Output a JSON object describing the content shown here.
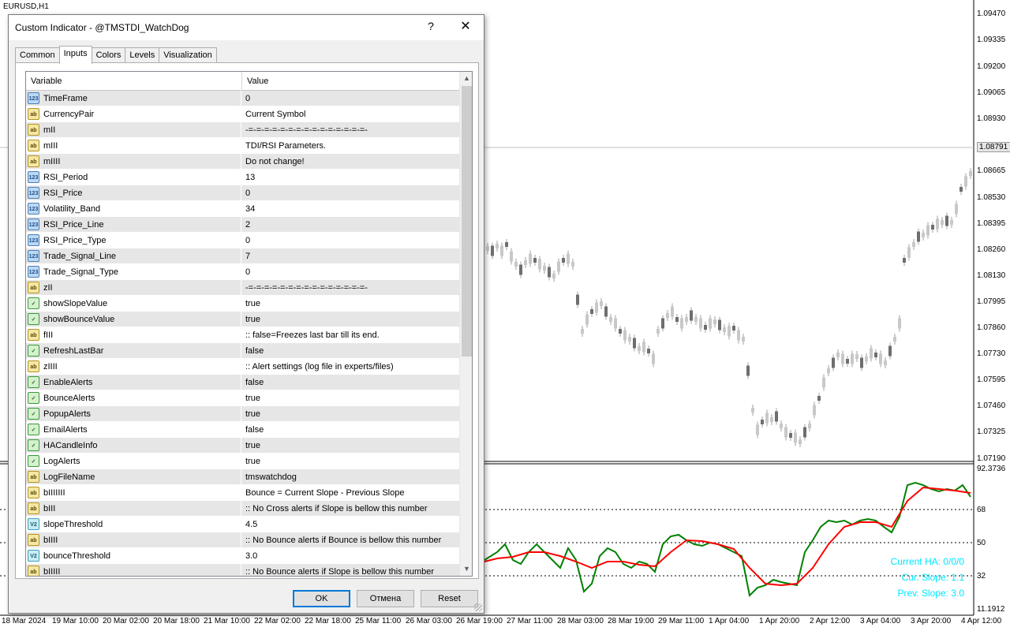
{
  "chart": {
    "symbol": "EURUSD,H1",
    "price_labels": [
      "1.09470",
      "1.09335",
      "1.09200",
      "1.09065",
      "1.08930",
      "1.08791",
      "1.08665",
      "1.08530",
      "1.08395",
      "1.08260",
      "1.08130",
      "1.07995",
      "1.07860",
      "1.07730",
      "1.07595",
      "1.07460",
      "1.07325",
      "1.07190"
    ],
    "current_price": "1.08791",
    "time_labels": [
      "18 Mar 2024",
      "19 Mar 10:00",
      "20 Mar 02:00",
      "20 Mar 18:00",
      "21 Mar 10:00",
      "22 Mar 02:00",
      "22 Mar 18:00",
      "25 Mar 11:00",
      "26 Mar 03:00",
      "26 Mar 19:00",
      "27 Mar 11:00",
      "28 Mar 03:00",
      "28 Mar 19:00",
      "29 Mar 11:00",
      "1 Apr 04:00",
      "1 Apr 20:00",
      "2 Apr 12:00",
      "3 Apr 04:00",
      "3 Apr 20:00",
      "4 Apr 12:00"
    ],
    "indicator": {
      "max_label": "92.3736",
      "min_label": "11.1912",
      "levels": [
        "68",
        "50",
        "32"
      ],
      "current_ha": "Current HA: 0/0/0",
      "cur_slope": "Cur. Slope: 1.1",
      "prev_slope": "Prev. Slope: 3.0",
      "text_color": "#00e5ff",
      "line_colors": {
        "green": "#008000",
        "red": "#ff0000"
      }
    }
  },
  "dialog": {
    "title": "Custom Indicator - @TMSTDI_WatchDog",
    "help": "?",
    "close": "✕",
    "tabs": [
      "Common",
      "Inputs",
      "Colors",
      "Levels",
      "Visualization"
    ],
    "active_tab": "Inputs",
    "grid": {
      "header_variable": "Variable",
      "header_value": "Value",
      "rows": [
        {
          "type": "int",
          "icon": "123",
          "name": "TimeFrame",
          "value": "0"
        },
        {
          "type": "str",
          "icon": "ab",
          "name": "CurrencyPair",
          "value": "Current Symbol"
        },
        {
          "type": "str",
          "icon": "ab",
          "name": "mII",
          "value": "-=-=-=-=-=-=-=-=-=-=-=-=-=-=-=-"
        },
        {
          "type": "str",
          "icon": "ab",
          "name": "mIII",
          "value": "TDI/RSI Parameters."
        },
        {
          "type": "str",
          "icon": "ab",
          "name": "mIIII",
          "value": "Do not change!"
        },
        {
          "type": "int",
          "icon": "123",
          "name": "RSI_Period",
          "value": "13"
        },
        {
          "type": "int",
          "icon": "123",
          "name": "RSI_Price",
          "value": "0"
        },
        {
          "type": "int",
          "icon": "123",
          "name": "Volatility_Band",
          "value": "34"
        },
        {
          "type": "int",
          "icon": "123",
          "name": "RSI_Price_Line",
          "value": "2"
        },
        {
          "type": "int",
          "icon": "123",
          "name": "RSI_Price_Type",
          "value": "0"
        },
        {
          "type": "int",
          "icon": "123",
          "name": "Trade_Signal_Line",
          "value": "7"
        },
        {
          "type": "int",
          "icon": "123",
          "name": "Trade_Signal_Type",
          "value": "0"
        },
        {
          "type": "str",
          "icon": "ab",
          "name": "zII",
          "value": "-=-=-=-=-=-=-=-=-=-=-=-=-=-=-=-"
        },
        {
          "type": "bool",
          "icon": "✓",
          "name": "showSlopeValue",
          "value": "true"
        },
        {
          "type": "bool",
          "icon": "✓",
          "name": "showBounceValue",
          "value": "true"
        },
        {
          "type": "str",
          "icon": "ab",
          "name": "fIII",
          "value": ":: false=Freezes last bar till its end."
        },
        {
          "type": "bool",
          "icon": "✓",
          "name": "RefreshLastBar",
          "value": "false"
        },
        {
          "type": "str",
          "icon": "ab",
          "name": "zIIII",
          "value": ":: Alert settings (log file in experts/files)"
        },
        {
          "type": "bool",
          "icon": "✓",
          "name": "EnableAlerts",
          "value": "false"
        },
        {
          "type": "bool",
          "icon": "✓",
          "name": "BounceAlerts",
          "value": "true"
        },
        {
          "type": "bool",
          "icon": "✓",
          "name": "PopupAlerts",
          "value": "true"
        },
        {
          "type": "bool",
          "icon": "✓",
          "name": "EmailAlerts",
          "value": "false"
        },
        {
          "type": "bool",
          "icon": "✓",
          "name": "HACandleInfo",
          "value": "true"
        },
        {
          "type": "bool",
          "icon": "✓",
          "name": "LogAlerts",
          "value": "true"
        },
        {
          "type": "str",
          "icon": "ab",
          "name": "LogFileName",
          "value": "tmswatchdog"
        },
        {
          "type": "str",
          "icon": "ab",
          "name": "bIIIIIII",
          "value": "Bounce = Current Slope - Previous Slope"
        },
        {
          "type": "str",
          "icon": "ab",
          "name": "bIII",
          "value": ":: No Cross alerts if Slope is bellow this number"
        },
        {
          "type": "dbl",
          "icon": "V2",
          "name": "slopeThreshold",
          "value": "4.5"
        },
        {
          "type": "str",
          "icon": "ab",
          "name": "bIIII",
          "value": ":: No Bounce alerts if Bounce is bellow this number"
        },
        {
          "type": "dbl",
          "icon": "V2",
          "name": "bounceThreshold",
          "value": "3.0"
        },
        {
          "type": "str",
          "icon": "ab",
          "name": "bIIIII",
          "value": ":: No Bounce alerts if Slope is bellow this number"
        }
      ]
    },
    "buttons": {
      "ok": "OK",
      "cancel": "Отмена",
      "reset": "Reset"
    }
  }
}
